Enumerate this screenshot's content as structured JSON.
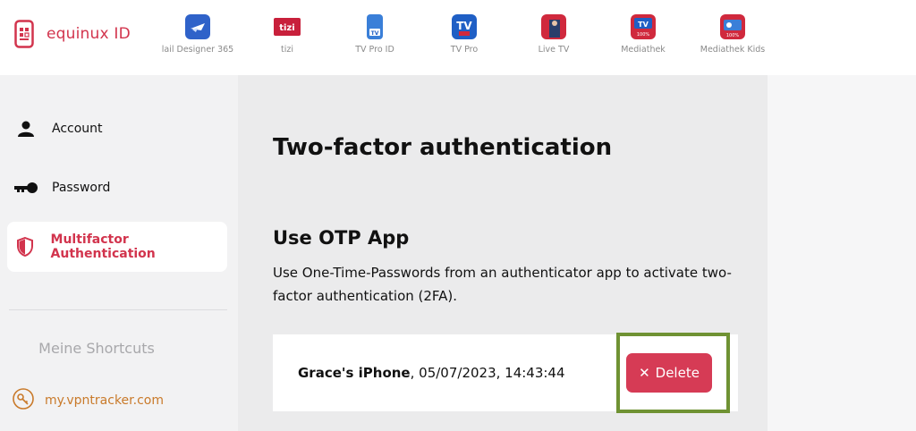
{
  "brand": {
    "name": "equinux ID",
    "accent": "#d2344d"
  },
  "apps": [
    {
      "label": "lail Designer 365",
      "icon": "mail-designer-icon",
      "color": "#2f62c9"
    },
    {
      "label": "tizi",
      "icon": "tizi-icon",
      "color": "#c8203b"
    },
    {
      "label": "TV Pro ID",
      "icon": "tv-pro-id-icon",
      "color": "#3a7fd8"
    },
    {
      "label": "TV Pro",
      "icon": "tv-pro-icon",
      "color": "#1f5fc5"
    },
    {
      "label": "Live TV",
      "icon": "live-tv-icon",
      "color": "#d0293d"
    },
    {
      "label": "Mediathek",
      "icon": "mediathek-icon",
      "color": "#d0293d"
    },
    {
      "label": "Mediathek Kids",
      "icon": "mediathek-kids-icon",
      "color": "#d0293d"
    }
  ],
  "sidebar": {
    "items": [
      {
        "label": "Account",
        "icon": "person-icon"
      },
      {
        "label": "Password",
        "icon": "key-icon"
      },
      {
        "label": "Multifactor Authentication",
        "icon": "shield-icon",
        "active": true
      }
    ],
    "shortcuts_title": "Meine Shortcuts",
    "shortcut": {
      "label": "my.vpntracker.com",
      "icon": "vpn-key-icon",
      "color": "#c97a2a"
    }
  },
  "main": {
    "title": "Two-factor authentication",
    "otp": {
      "title": "Use OTP App",
      "description": "Use One-Time-Passwords from an authenticator app to activate two-factor authentication (2FA)."
    },
    "device": {
      "name": "Grace's iPhone",
      "date": ", 05/07/2023, 14:43:44",
      "delete_label": "Delete",
      "delete_icon": "close-icon"
    }
  },
  "colors": {
    "delete": "#d63b55",
    "highlight": "#6f9233"
  }
}
